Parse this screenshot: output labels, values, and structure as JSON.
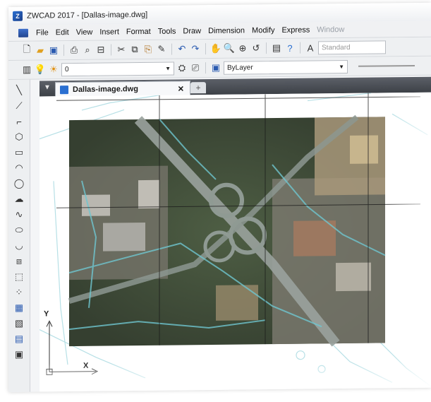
{
  "window": {
    "title": "ZWCAD 2017 - [Dallas-image.dwg]",
    "logo_letter": "Z"
  },
  "menubar": {
    "items": [
      "File",
      "Edit",
      "View",
      "Insert",
      "Format",
      "Tools",
      "Draw",
      "Dimension",
      "Modify",
      "Express",
      "Window"
    ]
  },
  "toolbar_top": {
    "text_style_value": "Standard"
  },
  "toolbar_layers": {
    "layer_value": "0",
    "color_value": "ByLayer"
  },
  "document": {
    "tab_label": "Dallas-image.dwg",
    "close_glyph": "✕",
    "new_tab_glyph": "+"
  },
  "axes": {
    "y_label": "Y",
    "x_label": "X"
  },
  "colors": {
    "accent": "#2a6fd1",
    "cad_lines": "#5fb8c4",
    "aerial_dark": "#3c4a3a"
  }
}
